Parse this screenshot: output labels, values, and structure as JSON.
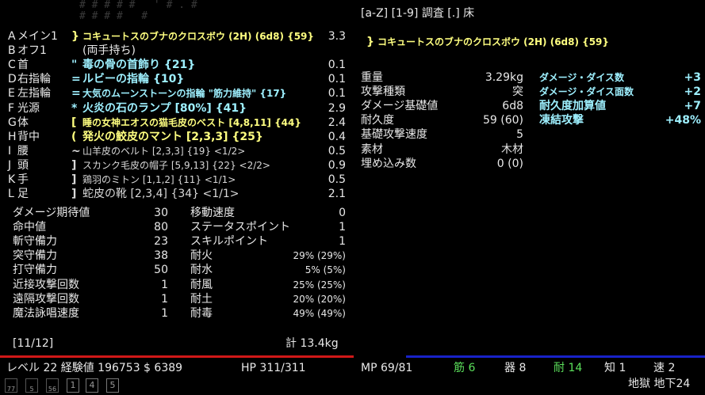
{
  "header": {
    "keys_hint": "[a-Z] [1-9] 調査 [.] 床"
  },
  "background_map": {
    "row1": "# # # # #   ' # . #",
    "row2": "# # # #   #"
  },
  "equipment": [
    {
      "letter": "A",
      "slot": "メイン1",
      "symbol": "}",
      "name": "コキュートスのブナのクロスボウ (2H) (6d8) {59}",
      "weight": "3.3",
      "color": "#ffff80"
    },
    {
      "letter": "B",
      "slot": "オフ1",
      "symbol": "",
      "name": "(両手持ち)",
      "weight": "",
      "color": "#e8e8e8"
    },
    {
      "letter": "C",
      "slot": "首",
      "symbol": "\"",
      "name": "毒の骨の首飾り {21}",
      "weight": "0.1",
      "color": "#9ef0ff"
    },
    {
      "letter": "D",
      "slot": "右指輪",
      "symbol": "=",
      "name": "ルビーの指輪 {10}",
      "weight": "0.1",
      "color": "#9ef0ff"
    },
    {
      "letter": "E",
      "slot": "左指輪",
      "symbol": "=",
      "name": "大気のムーンストーンの指輪 \"筋力維持\" {17}",
      "weight": "0.1",
      "color": "#9ef0ff"
    },
    {
      "letter": "F",
      "slot": "光源",
      "symbol": "*",
      "name": "火炎の石のランプ [80%] {41}",
      "weight": "2.9",
      "color": "#9ef0ff"
    },
    {
      "letter": "G",
      "slot": "体",
      "symbol": "[",
      "name": "睡の女神エオスの猫毛皮のベスト [4,8,11] {44}",
      "weight": "2.4",
      "color": "#ffff80"
    },
    {
      "letter": "H",
      "slot": "背中",
      "symbol": "(",
      "name": "発火の鮫皮のマント [2,3,3] {25}",
      "weight": "0.4",
      "color": "#ffff80"
    },
    {
      "letter": "I",
      "slot": "腰",
      "symbol": "~",
      "name": "山羊皮のベルト [2,3,3] {19} <1/2>",
      "weight": "0.5",
      "color": "#d8d8d8"
    },
    {
      "letter": "J",
      "slot": "頭",
      "symbol": "]",
      "name": "スカンク毛皮の帽子 [5,9,13] {22} <2/2>",
      "weight": "0.9",
      "color": "#d8d8d8"
    },
    {
      "letter": "K",
      "slot": "手",
      "symbol": "]",
      "name": "鶏羽のミトン [1,1,2] {11} <1/1>",
      "weight": "0.5",
      "color": "#d8d8d8"
    },
    {
      "letter": "L",
      "slot": "足",
      "symbol": "]",
      "name": "蛇皮の靴 [2,3,4] {34} <1/1>",
      "weight": "2.1",
      "color": "#d8d8d8"
    }
  ],
  "stats_left": [
    {
      "label": "ダメージ期待値",
      "value": "30"
    },
    {
      "label": "命中値",
      "value": "80"
    },
    {
      "label": "斬守備力",
      "value": "23"
    },
    {
      "label": "突守備力",
      "value": "38"
    },
    {
      "label": "打守備力",
      "value": "50"
    },
    {
      "label": "近接攻撃回数",
      "value": "1"
    },
    {
      "label": "遠隔攻撃回数",
      "value": "1"
    },
    {
      "label": "魔法詠唱速度",
      "value": "1"
    }
  ],
  "stats_right": [
    {
      "label": "移動速度",
      "value": "0"
    },
    {
      "label": "ステータスポイント",
      "value": "1"
    },
    {
      "label": "スキルポイント",
      "value": "1"
    },
    {
      "label": "耐火",
      "value": "29% (29%)"
    },
    {
      "label": "耐水",
      "value": "5% (5%)"
    },
    {
      "label": "耐風",
      "value": "25% (25%)"
    },
    {
      "label": "耐土",
      "value": "20% (20%)"
    },
    {
      "label": "耐毒",
      "value": "49% (49%)"
    }
  ],
  "slots_count": "[11/12]",
  "total_weight": "計 13.4kg",
  "detail": {
    "symbol": "}",
    "title": "コキュートスのブナのクロスボウ (2H) (6d8) {59}",
    "props": [
      {
        "label": "重量",
        "value": "3.29kg"
      },
      {
        "label": "攻撃種類",
        "value": "突"
      },
      {
        "label": "ダメージ基礎値",
        "value": "6d8"
      },
      {
        "label": "耐久度",
        "value": "59 (60)"
      },
      {
        "label": "基礎攻撃速度",
        "value": "5"
      },
      {
        "label": "素材",
        "value": "木材"
      },
      {
        "label": "埋め込み数",
        "value": "0 (0)"
      }
    ],
    "enchants": [
      {
        "label": "ダメージ・ダイス数",
        "value": "+3"
      },
      {
        "label": "ダメージ・ダイス面数",
        "value": "+2"
      },
      {
        "label": "耐久度加算値",
        "value": "+7"
      },
      {
        "label": "凍結攻撃",
        "value": "+48%"
      }
    ]
  },
  "status_bar": {
    "level": "レベル 22 経験値 196753 $ 6389",
    "hp": "HP 311/311",
    "mp": "MP 69/81",
    "str": "筋 6",
    "dex": "器 8",
    "con": "耐 14",
    "int": "知 1",
    "spd": "速 2",
    "location": "地獄 地下24"
  },
  "quickslots": [
    {
      "label": "77"
    },
    {
      "label": "5"
    },
    {
      "label": "56"
    },
    {
      "label": "1"
    },
    {
      "label": "4"
    },
    {
      "label": "5"
    }
  ],
  "colors": {
    "hp_bar": "#d01818",
    "mp_bar": "#1822c8",
    "highlight_yellow": "#ffff80",
    "highlight_cyan": "#9ef0ff",
    "stat_green": "#5be05b"
  }
}
